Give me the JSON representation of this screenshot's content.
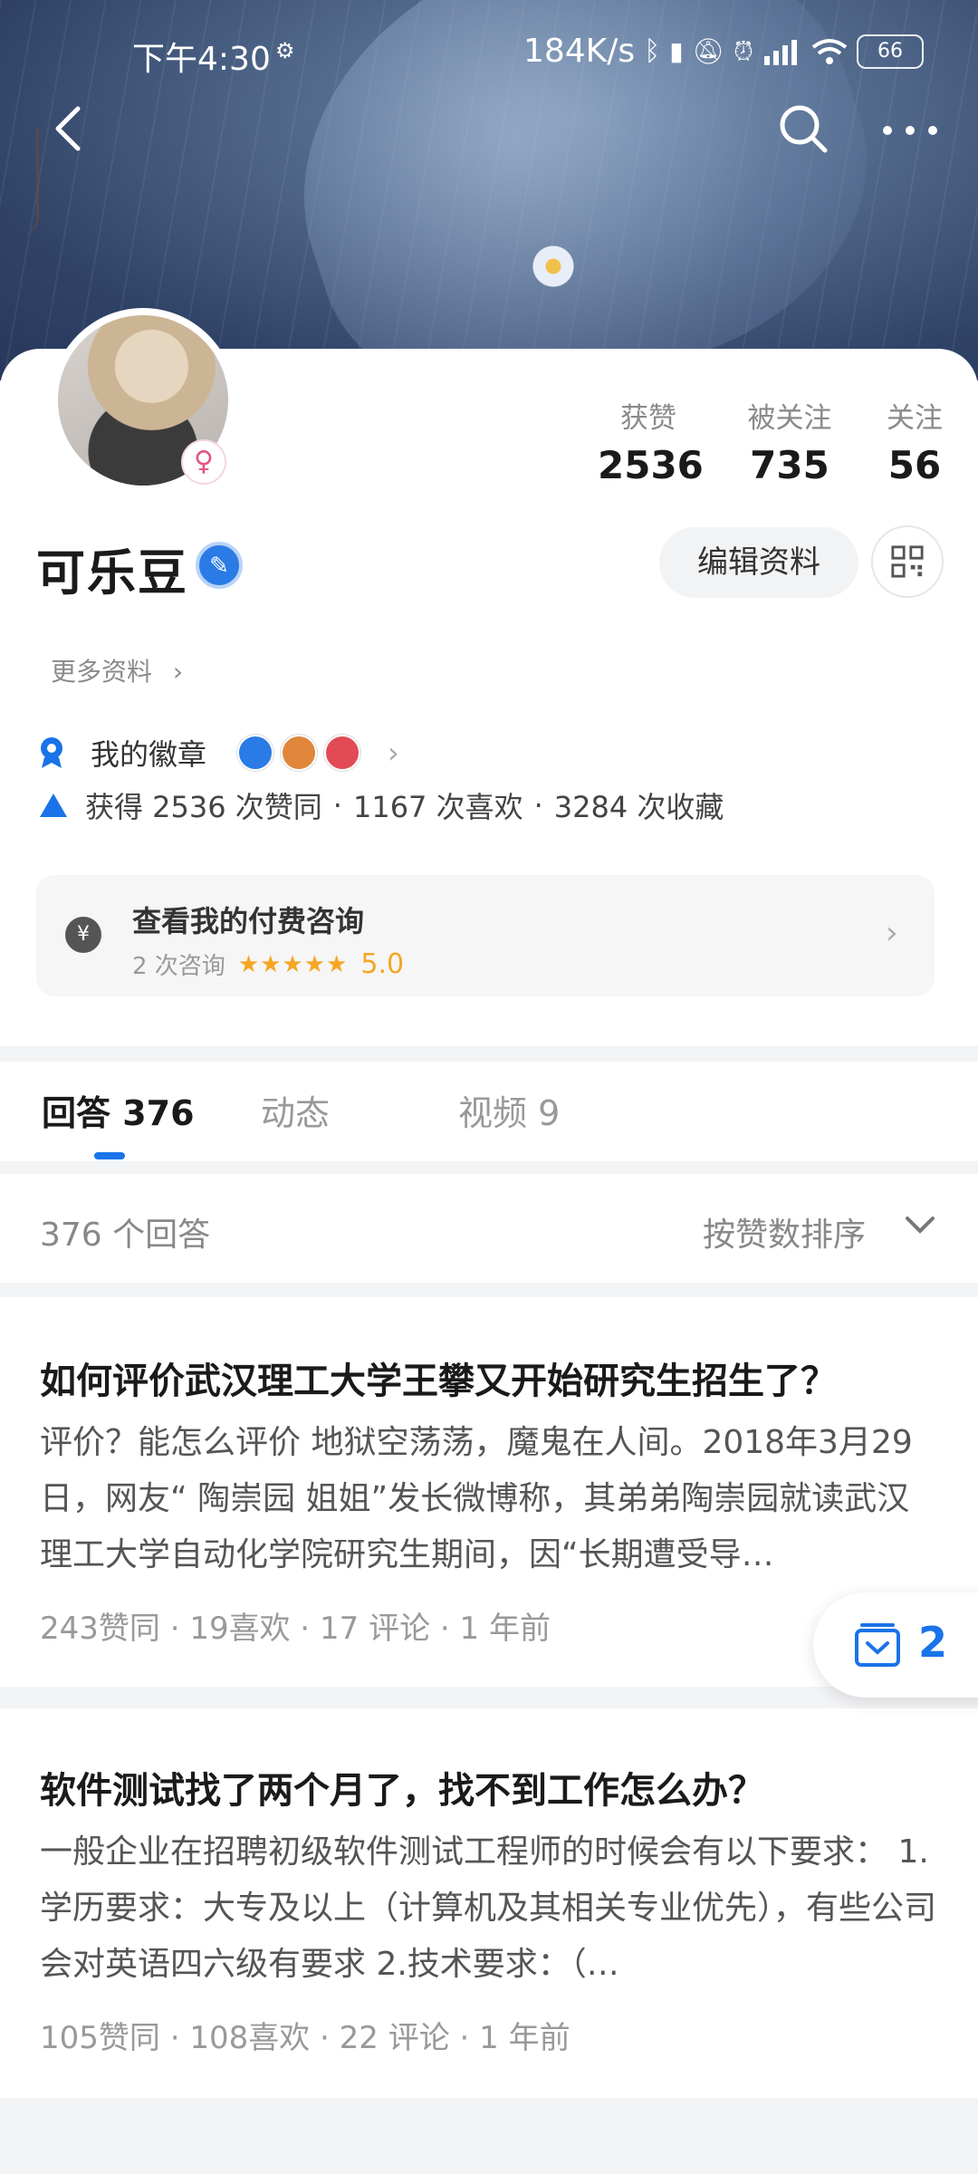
{
  "status_bar": {
    "time": "下午4:30",
    "network_speed": "184K/s",
    "battery": "66"
  },
  "profile": {
    "username": "可乐豆",
    "edit_label": "编辑资料",
    "more_info": "更多资料",
    "stats": [
      {
        "label": "获赞",
        "value": "2536"
      },
      {
        "label": "被关注",
        "value": "735"
      },
      {
        "label": "关注",
        "value": "56"
      }
    ]
  },
  "badges": {
    "label": "我的徽章"
  },
  "achievements": {
    "likes": "获得 2536 次赞同",
    "favs": "1167 次喜欢",
    "collects": "3284 次收藏",
    "separator": "·"
  },
  "consult": {
    "title": "查看我的付费咨询",
    "count": "2 次咨询",
    "stars": "★★★★★",
    "score": "5.0"
  },
  "tabs": [
    {
      "label": "回答 376"
    },
    {
      "label": "动态"
    },
    {
      "label": "视频 9"
    }
  ],
  "sort": {
    "count": "376 个回答",
    "order": "按赞数排序"
  },
  "answers": [
    {
      "title": "如何评价武汉理工大学王攀又开始研究生招生了？",
      "excerpt": "评价？能怎么评价 地狱空荡荡，魔鬼在人间。2018年3月29日，网友“ 陶崇园 姐姐”发长微博称，其弟弟陶崇园就读武汉理工大学自动化学院研究生期间，因“长期遭受导…",
      "meta": "243赞同 · 19喜欢 · 17 评论 · 1 年前"
    },
    {
      "title": "软件测试找了两个月了，找不到工作怎么办？",
      "excerpt": "一般企业在招聘初级软件测试工程师的时候会有以下要求： 1.学历要求：大专及以上（计算机及其相关专业优先），有些公司会对英语四六级有要求 2.技术要求：（…",
      "meta": "105赞同 · 108喜欢 · 22 评论 · 1 年前"
    }
  ],
  "fab": {
    "count": "2"
  }
}
